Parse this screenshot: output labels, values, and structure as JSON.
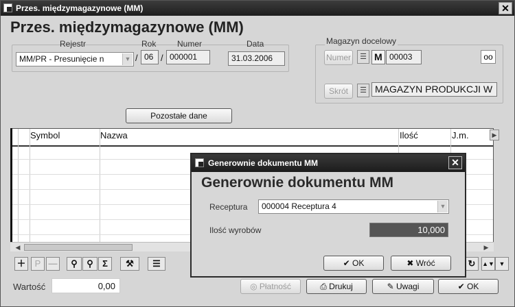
{
  "window": {
    "title": "Przes. międzymagazynowe (MM)",
    "close_glyph": "✕"
  },
  "header": {
    "big_title": "Przes. międzymagazynowe (MM)"
  },
  "doc": {
    "rejestr_label": "Rejestr",
    "rejestr_value": "MM/PR  - Presunięcie n",
    "rok_label": "Rok",
    "rok_value": "06",
    "numer_label": "Numer",
    "numer_value": "000001",
    "data_label": "Data",
    "data_value": "31.03.2006",
    "slash": "/"
  },
  "magazyn": {
    "group_label": "Magazyn docelowy",
    "numer_btn": "Numer",
    "m_label": "M",
    "code": "00003",
    "skrot_btn": "Skrót",
    "name": "MAGAZYN PRODUKCJI W"
  },
  "pozostale_btn": "Pozostałe dane",
  "grid": {
    "columns": [
      "Symbol",
      "Nazwa",
      "Ilość",
      "J.m."
    ]
  },
  "footer": {
    "wartosc_label": "Wartość",
    "wartosc_value": "0,00",
    "platnosc_btn": "Płatność",
    "drukuj_btn": "Drukuj",
    "uwagi_btn": "Uwagi",
    "ok_btn": "OK"
  },
  "dialog": {
    "title": "Generownie dokumentu  MM",
    "big_title": "Generownie dokumentu  MM",
    "receptura_label": "Receptura",
    "receptura_value": "000004 Receptura 4",
    "ilosc_label": "Ilość  wyrobów",
    "ilosc_value": "10,000",
    "ok_btn": "OK",
    "wroc_btn": "Wróć"
  }
}
